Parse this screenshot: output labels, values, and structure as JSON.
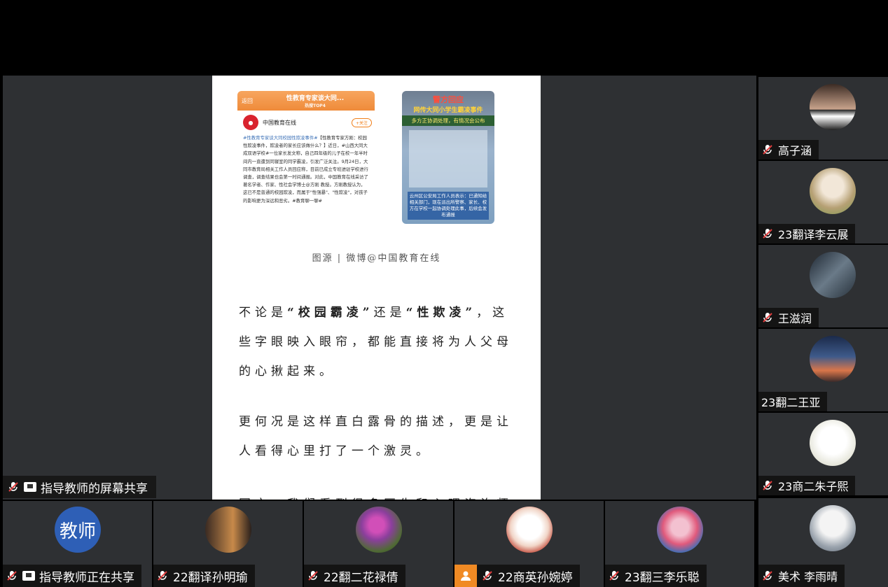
{
  "shared_screen": {
    "left_screenshot": {
      "back_label": "返回",
      "title": "性教育专家谈大同...",
      "subtitle": "热搜TOP4",
      "account_name": "中国教育在线",
      "follow_label": "+关注",
      "body_tag": "#性教育专家谈大同校园性欺凌事件#",
      "body_text": "【性教育专家方刚：校园性欺凌事件，欺凌者的家长应该做什么？】近日，#山西大同大成双语学校#一位家长发文称，自己四年级的儿子在校一年半时间内一直遭到同寝室的同学霸凌，引发广泛关注。9月24日，大同市教育局相关工作人员回应称，目前已成立专班进驻学校进行调查，调查结果也会第一时间通报。对此，中国教育在线采访了著名学者、作家、性社会学博士@方刚 教授。方刚教授认为，这已不是普通的校园欺凌，而属于\"性强暴\"、\"性欺凌\"，对孩子的影响更为深远和恶劣。#教育聊一聊#"
    },
    "right_screenshot": {
      "headline1": "警方回应",
      "headline2": "网传大同小学生霸凌事件",
      "headline3": "多方正协调处理，有情况会公布",
      "caption": "云州区公安局工作人员表示：已通知给相关部门，现在派出所警察、家长、校方在学校一起协调处理此事，后续会发布通报"
    },
    "credit": "图源 | 微博@中国教育在线",
    "para1_a": "不论是",
    "para1_b": "“校园霸凌”",
    "para1_c": "还是",
    "para1_d": "“性欺凌”",
    "para1_e": "，这些字眼映入眼帘，都能直接将为人父母的心揪起来。",
    "para2": "更何况是这样直白露骨的描述，更是让人看得心里打了一个激灵。",
    "para3": "同文，我们看到很多医生和心理咨询师"
  },
  "share_label": "指导教师的屏幕共享",
  "right_participants": [
    {
      "name": "高子涵",
      "muted": true
    },
    {
      "name": "23翻译李云展",
      "muted": true
    },
    {
      "name": "王滋润",
      "muted": true
    },
    {
      "name": "23翻二王亚",
      "muted": false
    },
    {
      "name": "23商二朱子熙",
      "muted": true
    },
    {
      "name": "美术 李雨晴",
      "muted": true
    }
  ],
  "bottom_participants": [
    {
      "name": "指导教师正在共享",
      "avatar_text": "教师",
      "muted": true
    },
    {
      "name": "22翻译孙明瑜",
      "muted": true
    },
    {
      "name": "22翻二花禄倩",
      "muted": true
    },
    {
      "name": "22商英孙婉婷",
      "muted": true
    },
    {
      "name": "23翻三李乐聪",
      "muted": true
    }
  ],
  "colors": {
    "stage_bg": "#2e3033",
    "teacher_avatar": "#2e5fb6",
    "person_icon": "#f08a24",
    "mute_red": "#e24040"
  }
}
